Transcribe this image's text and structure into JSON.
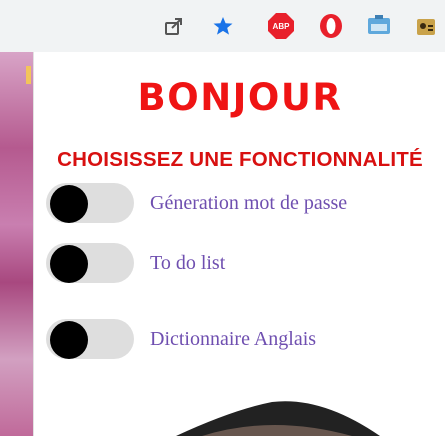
{
  "toolbar": {
    "icons": [
      "share-icon",
      "star-icon",
      "adblock-icon",
      "opera-icon",
      "screen-icon",
      "extension-icon"
    ],
    "colors": {
      "star": "#1a73e8",
      "adblock": "#e8202b",
      "opera": "#e8202b"
    }
  },
  "popup": {
    "title": "BONJOUR",
    "subtitle": "CHOISISSEZ UNE FONCTIONNALITÉ",
    "features": [
      {
        "label": "Géneration mot de passe",
        "enabled": false
      },
      {
        "label": "To do list",
        "enabled": false
      },
      {
        "label": "Dictionnaire Anglais",
        "enabled": false
      }
    ],
    "colors": {
      "title": "#ef1414",
      "feature_text": "#6f4fb0",
      "toggle_track": "#dedede",
      "knob": "#000000"
    }
  }
}
